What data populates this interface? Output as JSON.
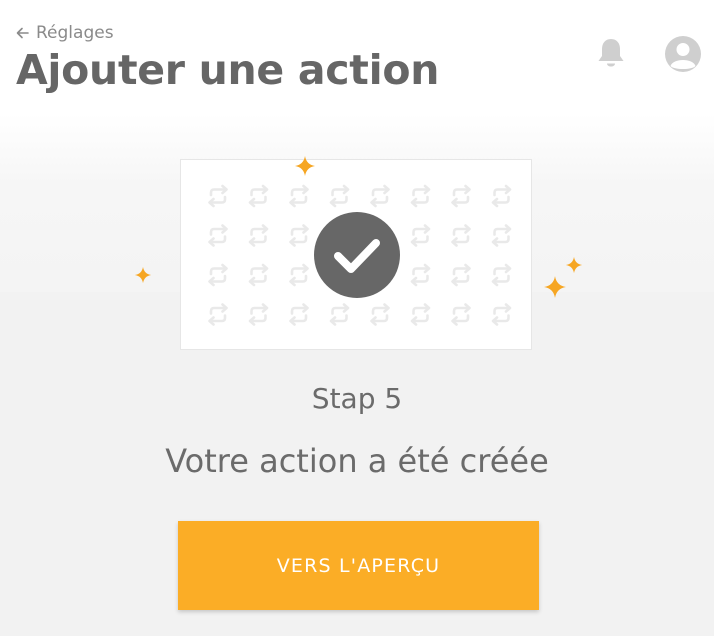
{
  "header": {
    "back_label": "Réglages",
    "title": "Ajouter une action",
    "icons": {
      "back": "arrow-left-icon",
      "notifications": "bell-icon",
      "account": "user-avatar-icon"
    }
  },
  "illustration": {
    "pattern_icon": "repeat-arrows-icon",
    "center_icon": "checkmark-icon",
    "decoration_icon": "sparkle-icon"
  },
  "step": {
    "label": "Stap 5"
  },
  "message": {
    "text": "Votre action a été créée"
  },
  "cta": {
    "label": "VERS L'APERÇU"
  },
  "colors": {
    "accent": "#fbad26",
    "sparkle": "#f6a623",
    "check_circle": "#676767",
    "title_text": "#666666",
    "body_text": "#6b6b6b",
    "pattern": "#e9e9e9"
  }
}
